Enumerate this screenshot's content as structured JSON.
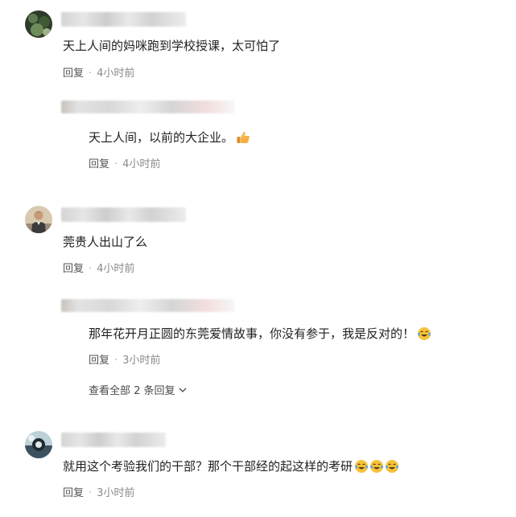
{
  "comments": [
    {
      "text": "天上人间的妈咪跑到学校授课，太可怕了",
      "reply_label": "回复",
      "time": "4小时前",
      "replies": [
        {
          "text": "天上人间，以前的大企业。",
          "emoji": "thumbs-up-icon",
          "reply_label": "回复",
          "time": "4小时前"
        }
      ]
    },
    {
      "text": "莞贵人出山了么",
      "reply_label": "回复",
      "time": "4小时前",
      "replies": [
        {
          "text": "那年花开月正圆的东莞爱情故事，你没有参于，我是反对的！",
          "emoji": "crying-laugh-icon",
          "reply_label": "回复",
          "time": "3小时前"
        }
      ],
      "more_replies": "查看全部 2 条回复"
    },
    {
      "text": "就用这个考验我们的干部？那个干部经的起这样的考研",
      "emoji": "crying-laugh-icon",
      "reply_label": "回复",
      "time": "3小时前"
    }
  ],
  "dot": "·",
  "colors": {
    "text": "#1f1f1f",
    "meta": "#8a8a8a",
    "emoji_yellow": "#f5c33b"
  }
}
